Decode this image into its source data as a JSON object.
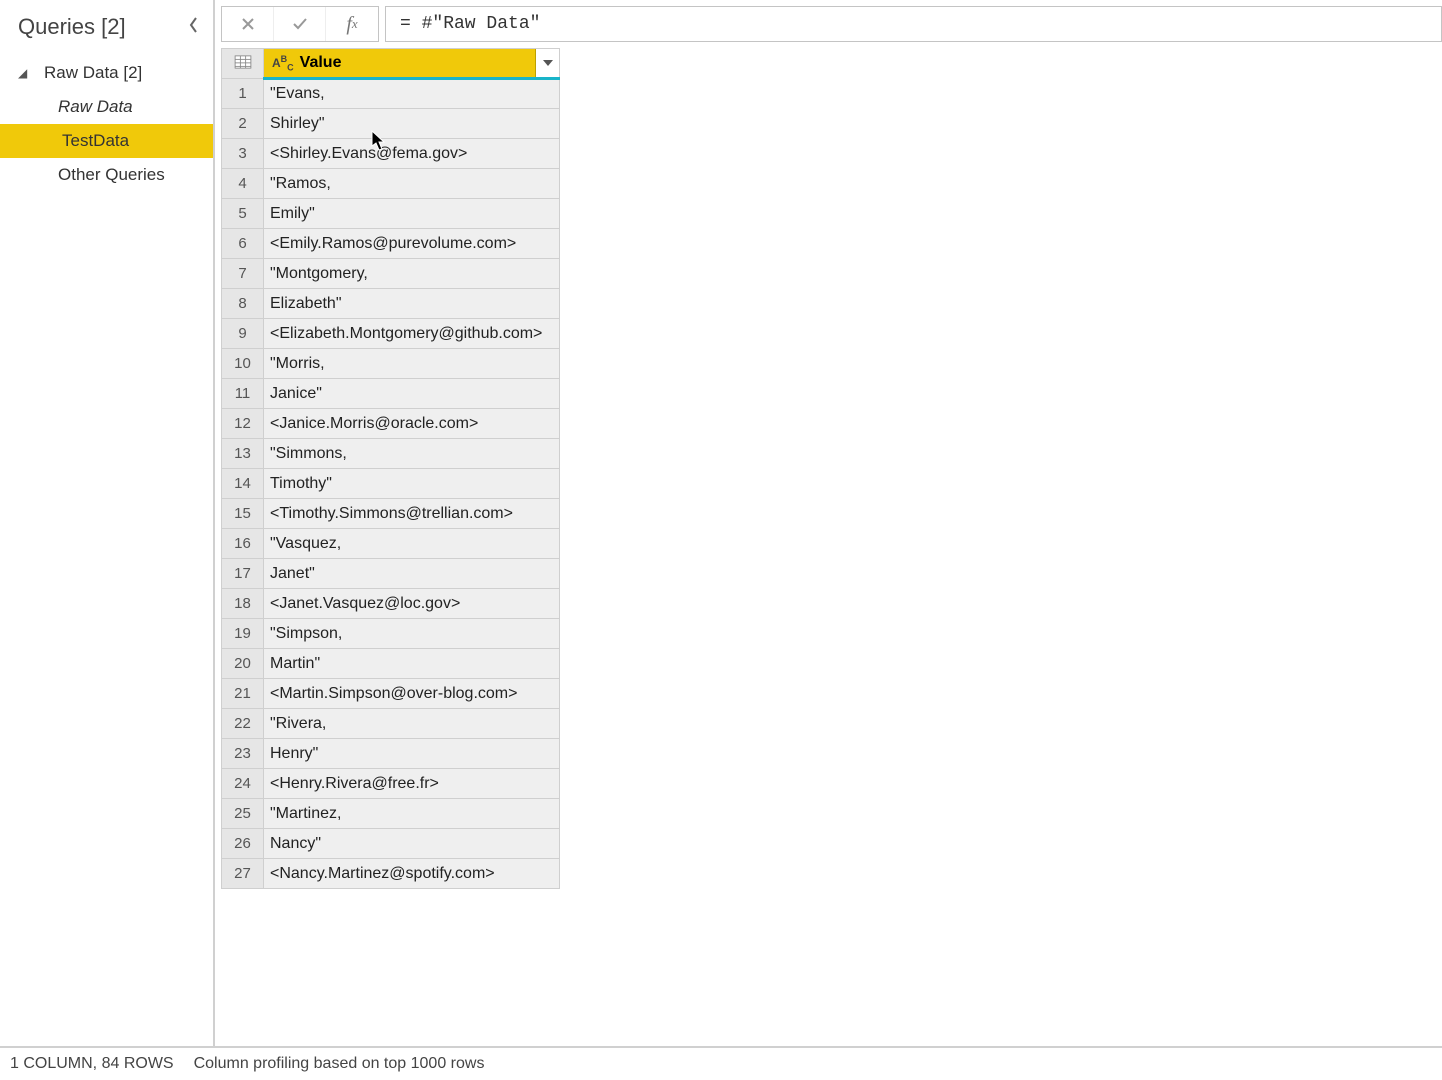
{
  "sidebar": {
    "title": "Queries [2]",
    "items": [
      {
        "type": "folder",
        "label": "Raw Data [2]",
        "depth": 0,
        "expanded": true,
        "italic": false,
        "selected": false
      },
      {
        "type": "table",
        "label": "Raw Data",
        "depth": 1,
        "expanded": false,
        "italic": true,
        "selected": false
      },
      {
        "type": "table",
        "label": "TestData",
        "depth": 1,
        "expanded": false,
        "italic": false,
        "selected": true
      },
      {
        "type": "folder",
        "label": "Other Queries",
        "depth": 1,
        "expanded": false,
        "italic": false,
        "selected": false
      }
    ]
  },
  "formula_bar": {
    "formula": "= #\"Raw Data\""
  },
  "grid": {
    "column_header": "Value",
    "type_label": "ABC",
    "rows": [
      "\"Evans,",
      "Shirley\"",
      "<Shirley.Evans@fema.gov>",
      "\"Ramos,",
      "Emily\"",
      "<Emily.Ramos@purevolume.com>",
      "\"Montgomery,",
      "Elizabeth\"",
      "<Elizabeth.Montgomery@github.com>",
      "\"Morris,",
      "Janice\"",
      "<Janice.Morris@oracle.com>",
      "\"Simmons,",
      "Timothy\"",
      "<Timothy.Simmons@trellian.com>",
      "\"Vasquez,",
      "Janet\"",
      "<Janet.Vasquez@loc.gov>",
      "\"Simpson,",
      "Martin\"",
      "<Martin.Simpson@over-blog.com>",
      "\"Rivera,",
      "Henry\"",
      "<Henry.Rivera@free.fr>",
      "\"Martinez,",
      "Nancy\"",
      "<Nancy.Martinez@spotify.com>"
    ]
  },
  "status_bar": {
    "summary": "1 COLUMN, 84 ROWS",
    "profiling": "Column profiling based on top 1000 rows"
  }
}
